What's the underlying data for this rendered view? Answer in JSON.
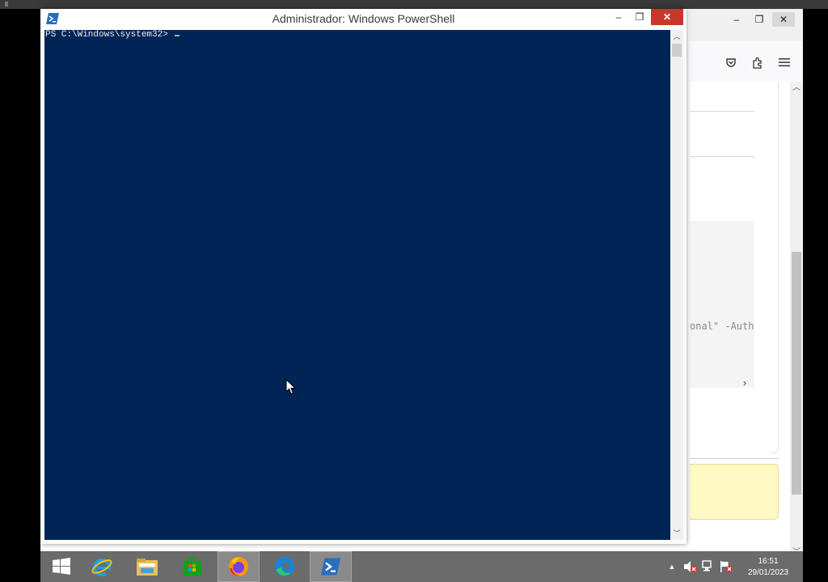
{
  "powershell": {
    "title": "Administrador: Windows PowerShell",
    "prompt": "PS C:\\Windows\\system32> ",
    "console_bg": "#012456",
    "close_glyph": "✕",
    "minimize_glyph": "‒",
    "restore_glyph": "❐"
  },
  "browser": {
    "partial_code_text": "onal\" -Auth",
    "notice_color": "#fff9c4"
  },
  "taskbar": {
    "items": [
      {
        "name": "Start",
        "icon": "windows-logo-icon"
      },
      {
        "name": "Internet Explorer",
        "icon": "internet-explorer-icon"
      },
      {
        "name": "File Explorer",
        "icon": "file-explorer-icon"
      },
      {
        "name": "Store",
        "icon": "store-icon"
      },
      {
        "name": "Firefox",
        "icon": "firefox-icon"
      },
      {
        "name": "Edge",
        "icon": "edge-icon"
      },
      {
        "name": "Windows PowerShell",
        "icon": "powershell-icon"
      }
    ],
    "time": "16:51",
    "date": "29/01/2023"
  }
}
